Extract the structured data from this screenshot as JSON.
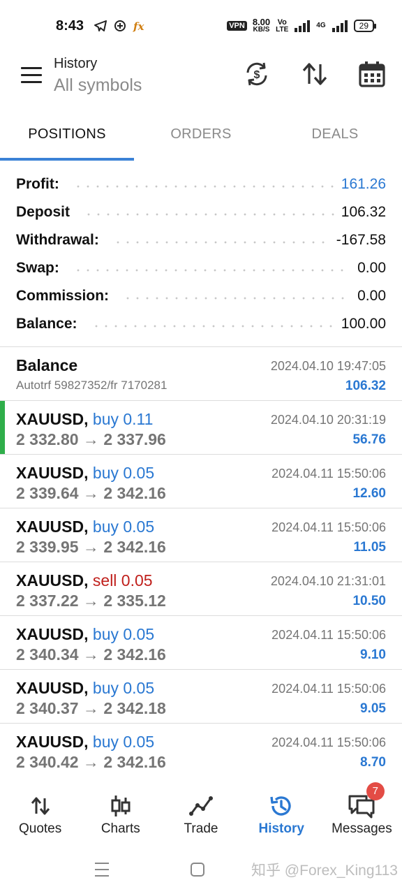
{
  "status_bar": {
    "time": "8:43",
    "vpn": "VPN",
    "speed_value": "8.00",
    "speed_unit": "KB/S",
    "volte_top": "Vo",
    "volte_bottom": "LTE",
    "network": "4G",
    "battery": "29"
  },
  "header": {
    "title": "History",
    "subtitle": "All symbols"
  },
  "tabs": [
    {
      "label": "POSITIONS",
      "active": true
    },
    {
      "label": "ORDERS",
      "active": false
    },
    {
      "label": "DEALS",
      "active": false
    }
  ],
  "summary": {
    "profit": {
      "label": "Profit:",
      "value": "161.26"
    },
    "deposit": {
      "label": "Deposit",
      "value": "106.32"
    },
    "withdrawal": {
      "label": "Withdrawal:",
      "value": "-167.58"
    },
    "swap": {
      "label": "Swap:",
      "value": "0.00"
    },
    "commission": {
      "label": "Commission:",
      "value": "0.00"
    },
    "balance": {
      "label": "Balance:",
      "value": "100.00"
    }
  },
  "balance_entry": {
    "title": "Balance",
    "note": "Autotrf 59827352/fr 7170281",
    "time": "2024.04.10 19:47:05",
    "amount": "106.32"
  },
  "deals": [
    {
      "symbol": "XAUUSD,",
      "side": "buy 0.11",
      "open": "2 332.80",
      "close": "2 337.96",
      "time": "2024.04.10 20:31:19",
      "profit": "56.76"
    },
    {
      "symbol": "XAUUSD,",
      "side": "buy 0.05",
      "open": "2 339.64",
      "close": "2 342.16",
      "time": "2024.04.11 15:50:06",
      "profit": "12.60"
    },
    {
      "symbol": "XAUUSD,",
      "side": "buy 0.05",
      "open": "2 339.95",
      "close": "2 342.16",
      "time": "2024.04.11 15:50:06",
      "profit": "11.05"
    },
    {
      "symbol": "XAUUSD,",
      "side": "sell 0.05",
      "open": "2 337.22",
      "close": "2 335.12",
      "time": "2024.04.10 21:31:01",
      "profit": "10.50"
    },
    {
      "symbol": "XAUUSD,",
      "side": "buy 0.05",
      "open": "2 340.34",
      "close": "2 342.16",
      "time": "2024.04.11 15:50:06",
      "profit": "9.10"
    },
    {
      "symbol": "XAUUSD,",
      "side": "buy 0.05",
      "open": "2 340.37",
      "close": "2 342.18",
      "time": "2024.04.11 15:50:06",
      "profit": "9.05"
    },
    {
      "symbol": "XAUUSD,",
      "side": "buy 0.05",
      "open": "2 340.42",
      "close": "2 342.16",
      "time": "2024.04.11 15:50:06",
      "profit": "8.70"
    }
  ],
  "arrow": "→",
  "bottom_nav": [
    {
      "label": "Quotes",
      "icon": "quotes-icon"
    },
    {
      "label": "Charts",
      "icon": "charts-icon"
    },
    {
      "label": "Trade",
      "icon": "trade-icon"
    },
    {
      "label": "History",
      "icon": "history-icon",
      "active": true
    },
    {
      "label": "Messages",
      "icon": "messages-icon",
      "badge": "7"
    }
  ],
  "watermark": "知乎 @Forex_King113",
  "colors": {
    "accent": "#2a78d2",
    "sell": "#c0201c",
    "highlight": "#2fae4a",
    "badge": "#e34c45"
  }
}
